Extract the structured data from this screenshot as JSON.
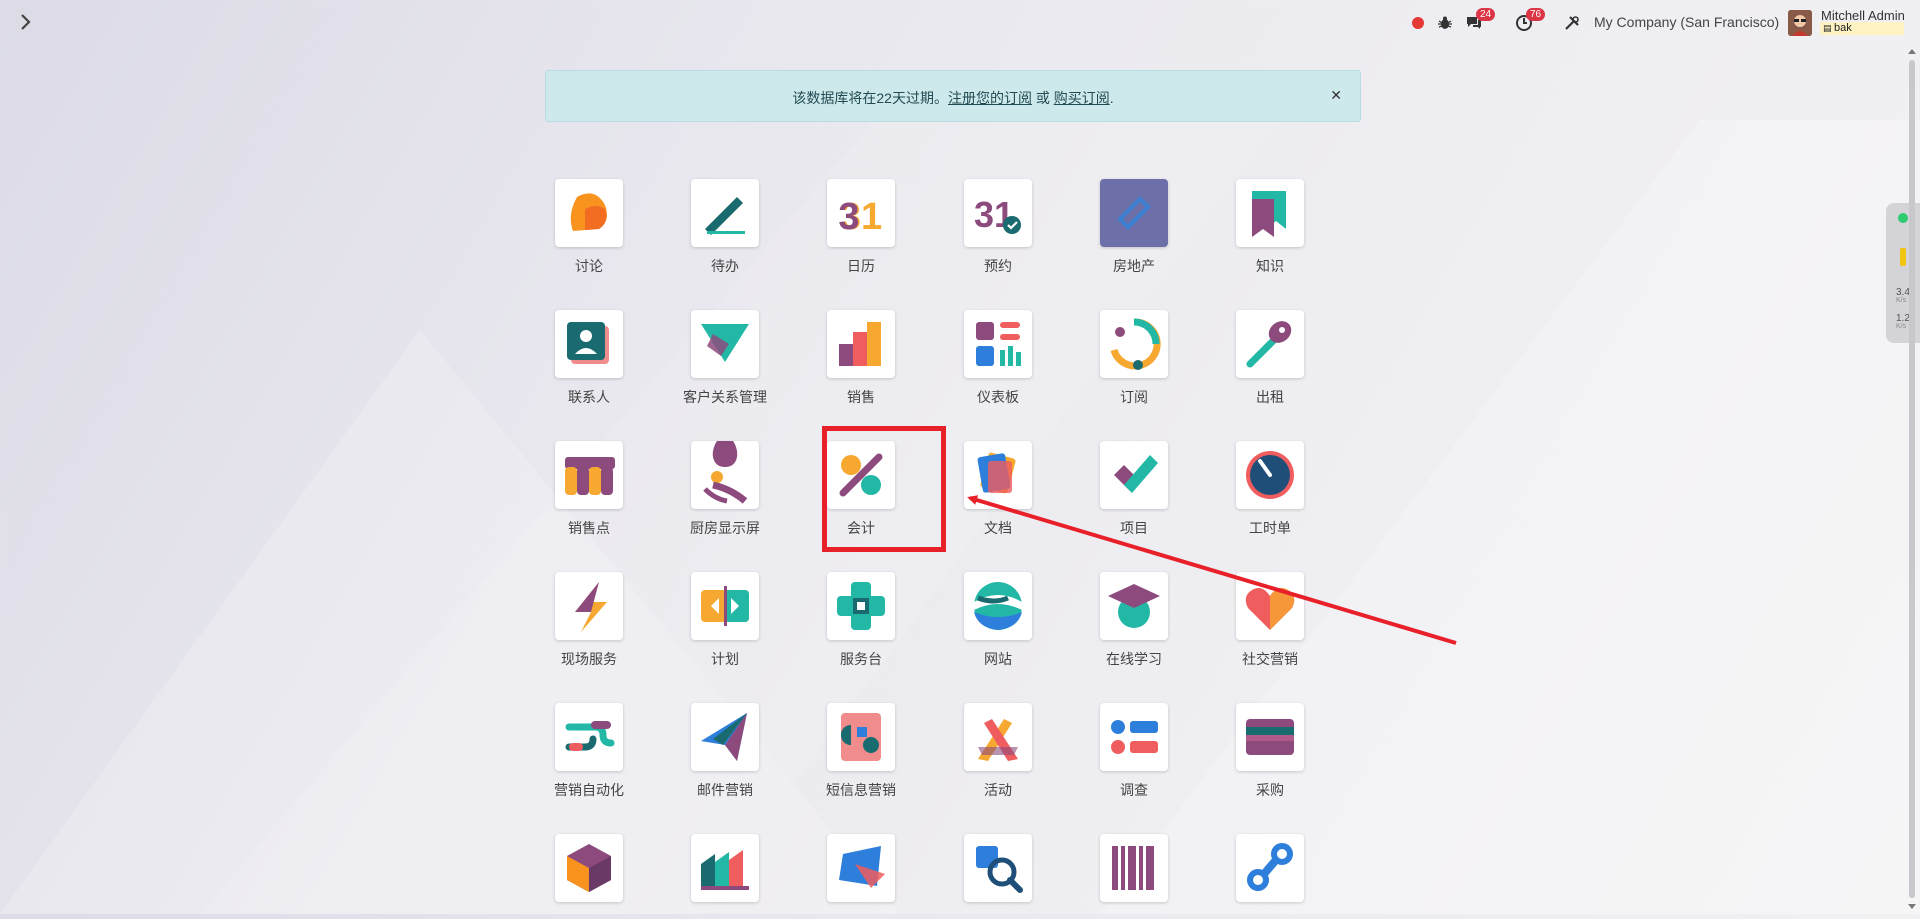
{
  "topbar": {
    "chat_badge": "24",
    "activity_badge": "76",
    "company": "My Company (San Francisco)",
    "user_name": "Mitchell Admin",
    "database": "bak"
  },
  "banner": {
    "text_before": "该数据库将在22天过期。",
    "link_register": "注册您的订阅",
    "text_or": " 或 ",
    "link_buy": "购买订阅",
    "text_end": "."
  },
  "apps": [
    {
      "label": "讨论",
      "icon": "discuss-icon"
    },
    {
      "label": "待办",
      "icon": "todo-icon"
    },
    {
      "label": "日历",
      "icon": "calendar-icon"
    },
    {
      "label": "预约",
      "icon": "appointment-icon"
    },
    {
      "label": "房地产",
      "icon": "real-estate-icon"
    },
    {
      "label": "知识",
      "icon": "knowledge-icon"
    },
    {
      "label": "联系人",
      "icon": "contacts-icon"
    },
    {
      "label": "客户关系管理",
      "icon": "crm-icon"
    },
    {
      "label": "销售",
      "icon": "sales-icon"
    },
    {
      "label": "仪表板",
      "icon": "dashboard-icon"
    },
    {
      "label": "订阅",
      "icon": "subscription-icon"
    },
    {
      "label": "出租",
      "icon": "rental-icon"
    },
    {
      "label": "销售点",
      "icon": "pos-icon"
    },
    {
      "label": "厨房显示屏",
      "icon": "kitchen-display-icon"
    },
    {
      "label": "会计",
      "icon": "accounting-icon"
    },
    {
      "label": "文档",
      "icon": "documents-icon"
    },
    {
      "label": "项目",
      "icon": "project-icon"
    },
    {
      "label": "工时单",
      "icon": "timesheet-icon"
    },
    {
      "label": "现场服务",
      "icon": "field-service-icon"
    },
    {
      "label": "计划",
      "icon": "planning-icon"
    },
    {
      "label": "服务台",
      "icon": "helpdesk-icon"
    },
    {
      "label": "网站",
      "icon": "website-icon"
    },
    {
      "label": "在线学习",
      "icon": "elearning-icon"
    },
    {
      "label": "社交营销",
      "icon": "social-marketing-icon"
    },
    {
      "label": "营销自动化",
      "icon": "marketing-automation-icon"
    },
    {
      "label": "邮件营销",
      "icon": "email-marketing-icon"
    },
    {
      "label": "短信息营销",
      "icon": "sms-marketing-icon"
    },
    {
      "label": "活动",
      "icon": "events-icon"
    },
    {
      "label": "调查",
      "icon": "surveys-icon"
    },
    {
      "label": "采购",
      "icon": "purchase-icon"
    },
    {
      "label": "",
      "icon": "inventory-icon"
    },
    {
      "label": "",
      "icon": "manufacturing-icon"
    },
    {
      "label": "",
      "icon": "repair-icon"
    },
    {
      "label": "",
      "icon": "quality-icon"
    },
    {
      "label": "",
      "icon": "barcode-icon"
    },
    {
      "label": "",
      "icon": "plm-icon"
    }
  ],
  "side_widget": {
    "up": "3.4",
    "down": "1.2",
    "unit": "K/s"
  },
  "colors": {
    "highlight": "#e8202a",
    "banner_bg": "#cde9ec",
    "badge": "#dc3545"
  }
}
